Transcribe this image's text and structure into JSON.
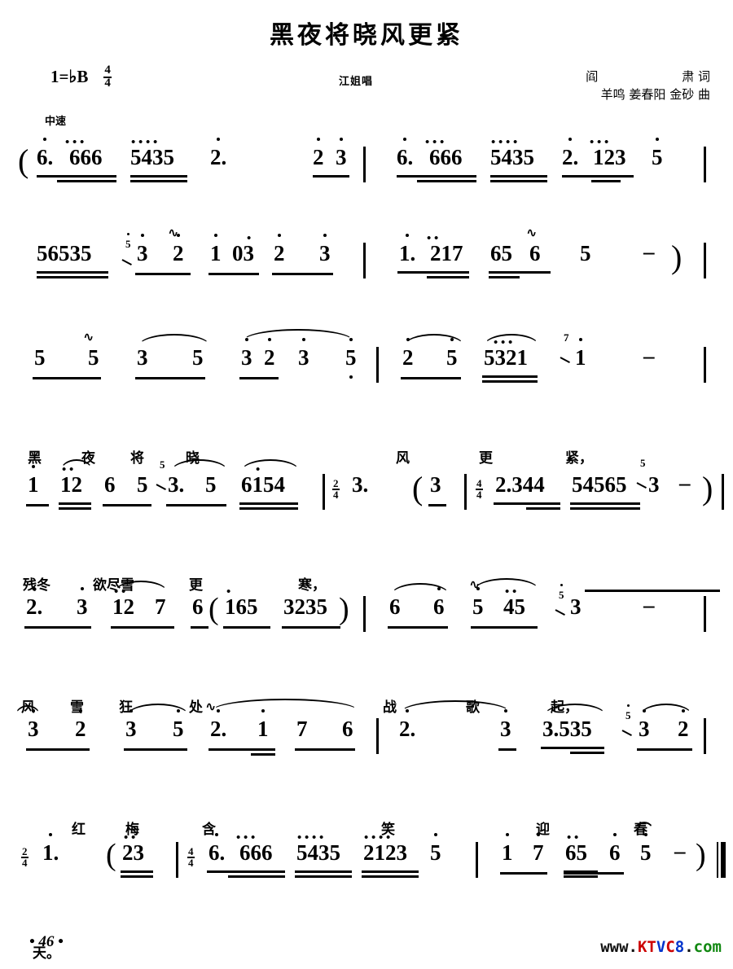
{
  "header": {
    "title": "黑夜将晓风更紧",
    "key_signature": "1=♭B",
    "flat_symbol": "♭",
    "time_signature_num": "4",
    "time_signature_den": "4",
    "tempo": "中速",
    "singer": "江姐唱",
    "lyricist_name": "阎",
    "lyricist_name2": "肃",
    "lyricist_role": "词",
    "composer_names": "羊鸣 姜春阳 金砂",
    "composer_role": "曲"
  },
  "footer": {
    "page_number": "• 46 •",
    "watermark_parts": [
      {
        "text": "www.",
        "color": "#111111"
      },
      {
        "text": "K",
        "color": "#cc0000"
      },
      {
        "text": "T",
        "color": "#cc0000"
      },
      {
        "text": "V",
        "color": "#cc0000"
      },
      {
        "text": "C",
        "color": "#cc0000"
      },
      {
        "text": "8",
        "color": "#0033cc"
      },
      {
        "text": ".",
        "color": "#111111"
      },
      {
        "text": "com",
        "color": "#118811"
      }
    ],
    "watermark_text": "www.KTVC8.com"
  },
  "chart_data": {
    "type": "table",
    "title": "黑夜将晓风更紧",
    "notation": "jianpu",
    "key": "1=♭B",
    "time": "4/4",
    "tempo_marking": "中速",
    "lines": [
      {
        "id": "line-1",
        "role": "intro",
        "notes": "( 6.666  5435  2.   2 3 | 6.666  5435  2.123  5 )",
        "lyrics": ""
      },
      {
        "id": "line-2",
        "role": "intro",
        "notes": "56535  5-3  2  1 03  2 3 | 1.217  65 6  5  -  )",
        "lyrics": ""
      },
      {
        "id": "line-3",
        "role": "verse",
        "notes": "5 5 3 5  3 2 3 5 | 2 5  5321  7-1  -",
        "lyrics": "黑 夜 将 晓  风 更 紧，"
      },
      {
        "id": "line-4",
        "role": "verse",
        "notes": "1 12 6 5 3.5 6154 | 2/4 3.  ( 3 | 4/4 2.344  54565 3  -  )",
        "lyrics": "残冬 欲尽雪 更 寒，"
      },
      {
        "id": "line-5",
        "role": "verse",
        "notes": "2. 3  12 7  6( 165  3235 ) | 6 6  5 45  5-3  -",
        "lyrics": "风 雪 狂 处  战 歌 起，"
      },
      {
        "id": "line-6",
        "role": "verse",
        "notes": "3 2  3 5  2. 1  7 6 | 2.  3  3.535  5-3 2",
        "lyrics": "红 梅 含 笑 迎 春"
      },
      {
        "id": "line-7",
        "role": "verse-outro",
        "notes": "2/4 1.  ( 23 | 4/4 6.666  5435  2123  5 | 1 7 65 6 5  -  )",
        "lyrics": "天。"
      }
    ],
    "lyrics_full": "黑夜将晓风更紧，残冬欲尽雪更寒，风雪狂处战歌起，红梅含笑迎春天。"
  },
  "staff": {
    "line1": {
      "paren_open": "(",
      "g1": "6.",
      "g1b": "666",
      "g2": "5435",
      "g3": "2.",
      "g4": "2",
      "g5": "3",
      "g6": "6.",
      "g6b": "666",
      "g7": "5435",
      "g8": "2.",
      "g8b": "123",
      "g9": "5"
    },
    "line2": {
      "g1": "56535",
      "grace1": "5",
      "g2": "3",
      "g3": "2",
      "g4": "1",
      "g5": "03",
      "g6": "2",
      "g7": "3",
      "g8": "1.",
      "g8b": "217",
      "g9": "65",
      "g10": "6",
      "g11": "5",
      "dash": "–",
      "paren_close": ")"
    },
    "line3": {
      "n1": "5",
      "n2": "5",
      "n3": "3",
      "n4": "5",
      "n5": "3",
      "n6": "2",
      "n7": "3",
      "n8": "5",
      "n9": "2",
      "n10": "5",
      "n11": "5321",
      "grace": "7",
      "n12": "1",
      "dash": "–",
      "ly1": "黑",
      "ly2": "夜",
      "ly3": "将",
      "ly4": "晓",
      "ly5": "风",
      "ly6": "更",
      "ly7": "紧，"
    },
    "line4": {
      "n1": "1",
      "n2": "12",
      "n3": "6",
      "n4": "5",
      "grace": "5",
      "n5": "3.",
      "n6": "5",
      "n7": "6154",
      "m_num": "2",
      "m_den": "4",
      "n8": "3.",
      "paren_open": "(",
      "n9": "3",
      "m2_num": "4",
      "m2_den": "4",
      "n10": "2.344",
      "n11": "54565",
      "grace2": "5",
      "n12": "3",
      "dash": "–",
      "paren_close": ")",
      "ly1": "残冬",
      "ly2": "欲尽雪",
      "ly3": "更",
      "ly4": "寒，"
    },
    "line5": {
      "n1": "2.",
      "n2": "3",
      "n3": "12",
      "n4": "7",
      "n5": "6",
      "paren_open": "(",
      "n6": "165",
      "n7": "3235",
      "paren_close": ")",
      "n8": "6",
      "n9": "6",
      "n10": "5",
      "n11": "45",
      "grace": "5",
      "n12": "3",
      "dash": "–",
      "ly1": "风",
      "ly2": "雪",
      "ly3": "狂",
      "ly4": "处",
      "ly5": "战",
      "ly6": "歌",
      "ly7": "起，"
    },
    "line6": {
      "n1": "3",
      "n2": "2",
      "n3": "3",
      "n4": "5",
      "n5": "2.",
      "n6": "1",
      "n7": "7",
      "n8": "6",
      "n9": "2.",
      "n10": "3",
      "n11": "3.535",
      "grace": "5",
      "n12": "3",
      "n13": "2",
      "ly1": "红",
      "ly2": "梅",
      "ly3": "含",
      "ly4": "笑",
      "ly5": "迎",
      "ly6": "春"
    },
    "line7": {
      "m_num": "2",
      "m_den": "4",
      "n1": "1.",
      "paren_open": "(",
      "n2": "23",
      "m2_num": "4",
      "m2_den": "4",
      "n3": "6.",
      "n3b": "666",
      "n4": "5435",
      "n5": "2123",
      "n6": "5",
      "n7": "1",
      "n8": "7",
      "n9": "65",
      "n10": "6",
      "n11": "5",
      "dash": "–",
      "paren_close": ")",
      "ly1": "天。"
    }
  }
}
